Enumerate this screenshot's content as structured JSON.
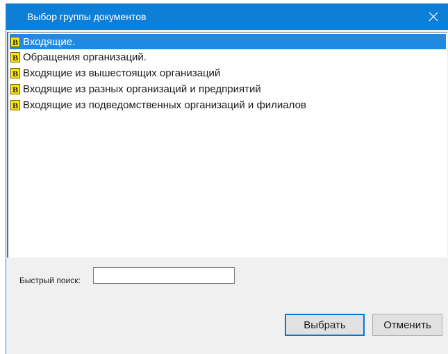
{
  "window": {
    "title": "Выбор группы документов",
    "accent_color": "#0e7fd6",
    "close_icon": "close-icon"
  },
  "list": {
    "item_icon": "document-group-icon",
    "items": [
      {
        "label": "Входящие.",
        "selected": true
      },
      {
        "label": "Обращения организаций.",
        "selected": false
      },
      {
        "label": "Входящие из вышестоящих организаций",
        "selected": false
      },
      {
        "label": "Входящие из разных организаций и предприятий",
        "selected": false
      },
      {
        "label": "Входящие из подведомственных организаций и филиалов",
        "selected": false
      }
    ]
  },
  "search": {
    "label": "Быстрый поиск:",
    "value": ""
  },
  "buttons": {
    "select_label": "Выбрать",
    "cancel_label": "Отменить"
  }
}
